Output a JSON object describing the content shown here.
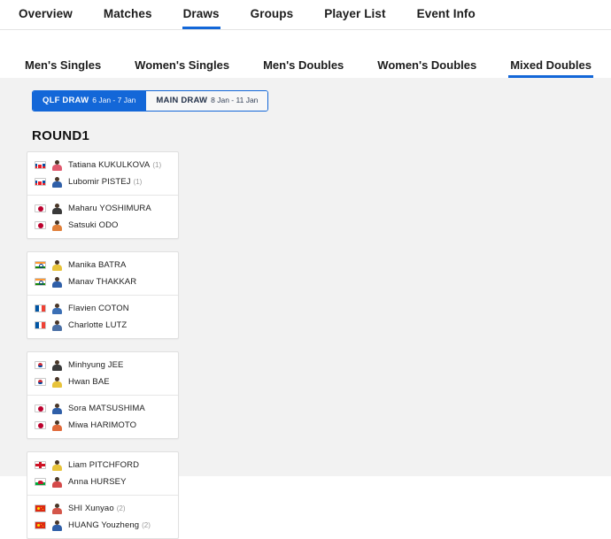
{
  "topnav": {
    "items": [
      {
        "label": "Overview",
        "active": false
      },
      {
        "label": "Matches",
        "active": false
      },
      {
        "label": "Draws",
        "active": true
      },
      {
        "label": "Groups",
        "active": false
      },
      {
        "label": "Player List",
        "active": false
      },
      {
        "label": "Event Info",
        "active": false
      }
    ]
  },
  "subnav": {
    "items": [
      {
        "label": "Men's Singles",
        "active": false
      },
      {
        "label": "Women's Singles",
        "active": false
      },
      {
        "label": "Men's Doubles",
        "active": false
      },
      {
        "label": "Women's Doubles",
        "active": false
      },
      {
        "label": "Mixed Doubles",
        "active": true
      }
    ]
  },
  "draw_toggle": {
    "options": [
      {
        "label": "QLF DRAW",
        "dates": "6 Jan - 7 Jan",
        "active": true
      },
      {
        "label": "MAIN DRAW",
        "dates": "8 Jan - 11 Jan",
        "active": false
      }
    ]
  },
  "round": {
    "title": "ROUND1"
  },
  "colors": {
    "accent": "#1367d8",
    "page_background": "#f2f2f2",
    "card_background": "#ffffff",
    "text": "#1d1d1d",
    "seed_text": "#9a9a9a"
  },
  "matches": [
    {
      "teams": [
        {
          "players": [
            {
              "name": "Tatiana KUKULKOVA",
              "seed": "(1)",
              "flag": "svk",
              "shirt": "#e05a6e"
            },
            {
              "name": "Lubomir PISTEJ",
              "seed": "(1)",
              "flag": "svk",
              "shirt": "#2f5fa8"
            }
          ]
        },
        {
          "players": [
            {
              "name": "Maharu YOSHIMURA",
              "seed": "",
              "flag": "jpn",
              "shirt": "#3a3a3a"
            },
            {
              "name": "Satsuki ODO",
              "seed": "",
              "flag": "jpn",
              "shirt": "#e0803a"
            }
          ]
        }
      ]
    },
    {
      "teams": [
        {
          "players": [
            {
              "name": "Manika BATRA",
              "seed": "",
              "flag": "ind",
              "shirt": "#e8c33a"
            },
            {
              "name": "Manav THAKKAR",
              "seed": "",
              "flag": "ind",
              "shirt": "#2f5fa8"
            }
          ]
        },
        {
          "players": [
            {
              "name": "Flavien COTON",
              "seed": "",
              "flag": "fra",
              "shirt": "#3b6fb5"
            },
            {
              "name": "Charlotte LUTZ",
              "seed": "",
              "flag": "fra",
              "shirt": "#4a6fa5"
            }
          ]
        }
      ]
    },
    {
      "teams": [
        {
          "players": [
            {
              "name": "Minhyung JEE",
              "seed": "",
              "flag": "kor",
              "shirt": "#3a3a3a"
            },
            {
              "name": "Hwan BAE",
              "seed": "",
              "flag": "kor",
              "shirt": "#e8c33a"
            }
          ]
        },
        {
          "players": [
            {
              "name": "Sora MATSUSHIMA",
              "seed": "",
              "flag": "jpn",
              "shirt": "#2f5fa8"
            },
            {
              "name": "Miwa HARIMOTO",
              "seed": "",
              "flag": "jpn",
              "shirt": "#e06a3a"
            }
          ]
        }
      ]
    },
    {
      "teams": [
        {
          "players": [
            {
              "name": "Liam PITCHFORD",
              "seed": "",
              "flag": "eng",
              "shirt": "#e8c33a"
            },
            {
              "name": "Anna HURSEY",
              "seed": "",
              "flag": "wal",
              "shirt": "#d44a4a"
            }
          ]
        },
        {
          "players": [
            {
              "name": "SHI Xunyao",
              "seed": "(2)",
              "flag": "chn",
              "shirt": "#d4564a"
            },
            {
              "name": "HUANG Youzheng",
              "seed": "(2)",
              "flag": "chn",
              "shirt": "#2f5fa8"
            }
          ]
        }
      ]
    }
  ]
}
